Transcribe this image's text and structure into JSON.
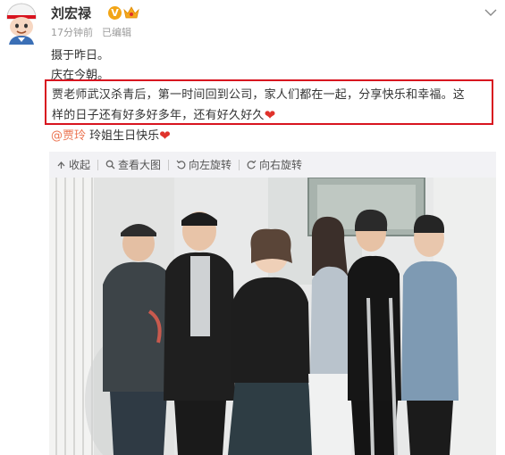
{
  "user": {
    "name": "刘宏禄",
    "time": "17分钟前",
    "edited": "已编辑",
    "badge_v": "V"
  },
  "post": {
    "line1": "摄于昨日。",
    "line2": "庆在今朝。",
    "highlight_line1": "贾老师武汉杀青后，第一时间回到公司，家人们都在一起，分享快乐和幸福。这",
    "highlight_line2": "样的日子还有好多好多年，还有好久好久",
    "mention": "@贾玲",
    "mention_text": " 玲姐生日快乐"
  },
  "toolbar": {
    "collapse": "收起",
    "view_large": "查看大图",
    "rotate_left": "向左旋转",
    "rotate_right": "向右旋转"
  },
  "colors": {
    "highlight_border": "#d8141f",
    "mention": "#eb7350",
    "heart": "#e0322b",
    "badge_v": "#f2a516"
  },
  "icons": [
    "avatar",
    "vip-v-icon",
    "crown-icon",
    "chevron-down-icon",
    "heart-icon",
    "collapse-icon",
    "search-icon",
    "rotate-left-icon",
    "rotate-right-icon"
  ]
}
